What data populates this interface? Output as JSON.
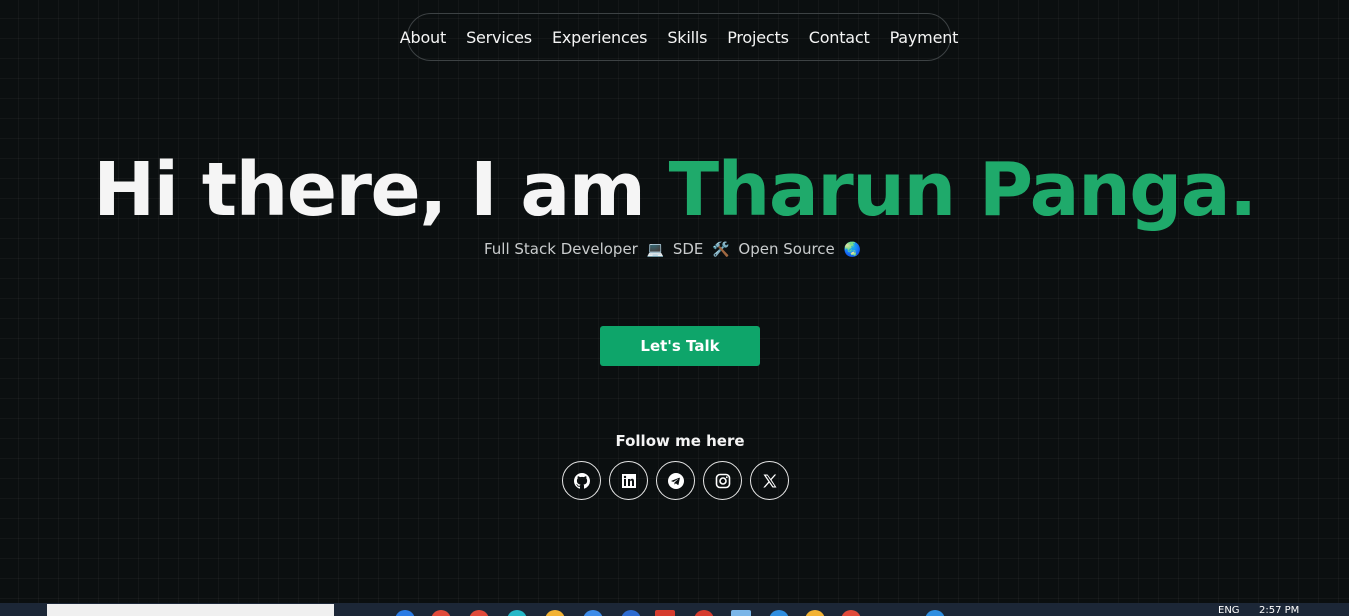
{
  "nav": {
    "items": [
      {
        "label": "About"
      },
      {
        "label": "Services"
      },
      {
        "label": "Experiences"
      },
      {
        "label": "Skills"
      },
      {
        "label": "Projects"
      },
      {
        "label": "Contact"
      },
      {
        "label": "Payment"
      }
    ]
  },
  "hero": {
    "greeting": "Hi there, I am",
    "name": "Tharun Panga.",
    "subtitle_parts": [
      "Full Stack Developer",
      "💻",
      "SDE",
      "🛠️",
      "Open Source",
      "🌏"
    ],
    "cta_label": "Let's Talk",
    "colors": {
      "accent": "#1faa6b",
      "button": "#0ea56a"
    }
  },
  "social": {
    "label": "Follow me here",
    "links": [
      {
        "icon": "github-icon"
      },
      {
        "icon": "linkedin-icon"
      },
      {
        "icon": "telegram-icon"
      },
      {
        "icon": "instagram-icon"
      },
      {
        "icon": "x-twitter-icon"
      }
    ]
  },
  "taskbar": {
    "language": "ENG",
    "time": "2:57 PM"
  }
}
